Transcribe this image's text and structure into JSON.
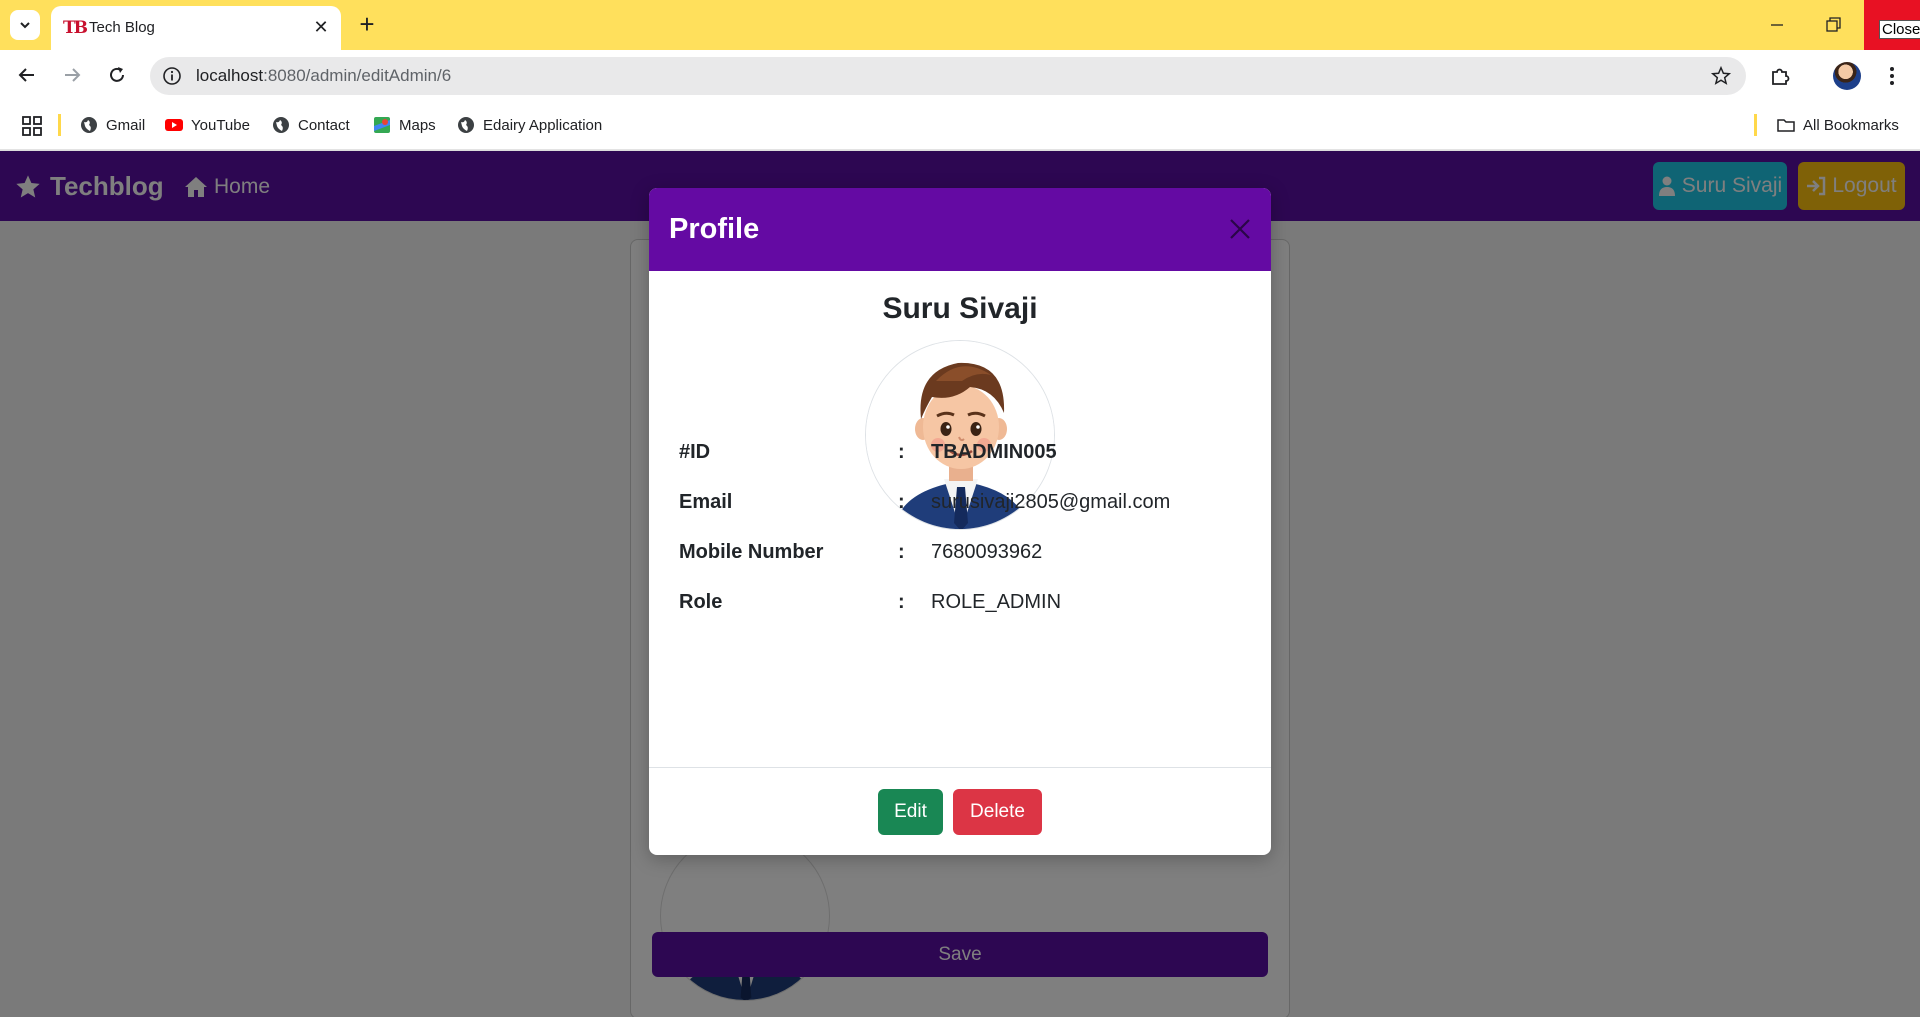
{
  "browser": {
    "tab": {
      "title": "Tech Blog",
      "favicon_text": "TB"
    },
    "close_tooltip": "Close",
    "address": {
      "host": "localhost",
      "path": ":8080/admin/editAdmin/6"
    },
    "bookmarks": [
      {
        "label": "Gmail",
        "icon": "globe-icon"
      },
      {
        "label": "YouTube",
        "icon": "youtube-icon"
      },
      {
        "label": "Contact",
        "icon": "globe-icon"
      },
      {
        "label": "Maps",
        "icon": "maps-icon"
      },
      {
        "label": "Edairy Application",
        "icon": "globe-icon"
      }
    ],
    "all_bookmarks": "All Bookmarks"
  },
  "navbar": {
    "brand": "Techblog",
    "home": "Home",
    "user_button": "Suru Sivaji",
    "logout_button": "Logout",
    "colors": {
      "navbar": "#5a0fa4",
      "user": "#1fc9e8",
      "logout": "#ffc20e"
    }
  },
  "page": {
    "save_button": "Save"
  },
  "modal": {
    "title": "Profile",
    "name": "Suru Sivaji",
    "fields": [
      {
        "label": "#ID",
        "value": "TBADMIN005"
      },
      {
        "label": "Email",
        "value": "surusivaji2805@gmail.com"
      },
      {
        "label": "Mobile Number",
        "value": "7680093962"
      },
      {
        "label": "Role",
        "value": "ROLE_ADMIN"
      }
    ],
    "separator": ":",
    "edit_button": "Edit",
    "delete_button": "Delete",
    "colors": {
      "header": "#640aa3",
      "edit": "#198754",
      "delete": "#dc3545"
    }
  }
}
